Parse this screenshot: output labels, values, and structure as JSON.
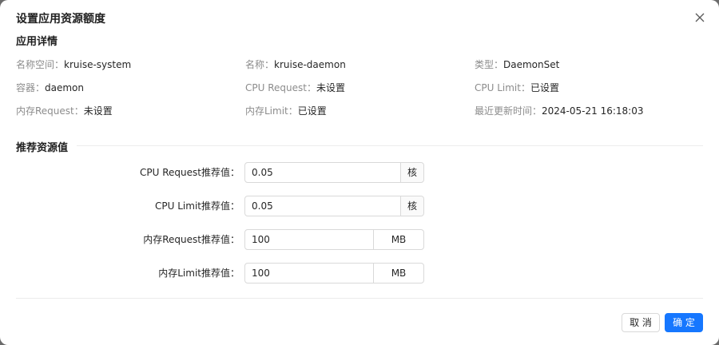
{
  "dialog": {
    "title": "设置应用资源额度",
    "close_icon": "close-icon"
  },
  "details": {
    "section_title": "应用详情",
    "rows": [
      [
        {
          "key": "名称空间：",
          "value": "kruise-system"
        },
        {
          "key": "名称：",
          "value": "kruise-daemon"
        },
        {
          "key": "类型：",
          "value": "DaemonSet"
        }
      ],
      [
        {
          "key": "容器：",
          "value": "daemon"
        },
        {
          "key": "CPU Request：",
          "value": "未设置"
        },
        {
          "key": "CPU Limit：",
          "value": "已设置"
        }
      ],
      [
        {
          "key": "内存Request：",
          "value": "未设置"
        },
        {
          "key": "内存Limit：",
          "value": "已设置"
        },
        {
          "key": "最近更新时间：",
          "value": "2024-05-21 16:18:03"
        }
      ]
    ]
  },
  "recommend": {
    "section_title": "推荐资源值",
    "fields": [
      {
        "label": "CPU Request推荐值：",
        "value": "0.05",
        "unit": "核"
      },
      {
        "label": "CPU Limit推荐值：",
        "value": "0.05",
        "unit": "核"
      },
      {
        "label": "内存Request推荐值：",
        "value": "100",
        "unit": "MB"
      },
      {
        "label": "内存Limit推荐值：",
        "value": "100",
        "unit": "MB"
      }
    ]
  },
  "footer": {
    "cancel_label": "取 消",
    "ok_label": "确 定"
  },
  "colors": {
    "primary": "#1677ff",
    "label_gray": "#8c8c8c",
    "border": "#d9d9d9"
  }
}
